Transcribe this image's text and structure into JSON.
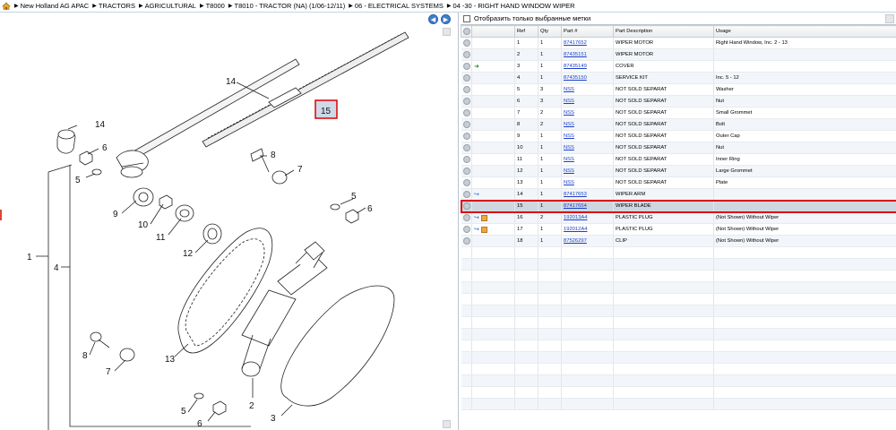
{
  "breadcrumb": {
    "items": [
      "New Holland AG APAC",
      "TRACTORS",
      "AGRICULTURAL",
      "T8000",
      "T8010 - TRACTOR (NA) (1/06-12/11)",
      "06 - ELECTRICAL SYSTEMS",
      "04 -30 - RIGHT HAND WINDOW WIPER"
    ]
  },
  "filter": {
    "label": "Отобразить только выбранные метки"
  },
  "table": {
    "headers": [
      "",
      "",
      "Ref",
      "Qty",
      "Part #",
      "Part Description",
      "Usage"
    ],
    "rows": [
      {
        "ref": "1",
        "qty": "1",
        "part": "87417652",
        "desc": "WIPER MOTOR",
        "usage": "Right Hand Window, Inc. 2 - 13",
        "icons": "none"
      },
      {
        "ref": "2",
        "qty": "1",
        "part": "87435151",
        "desc": "WIPER MOTOR",
        "usage": "",
        "icons": "none"
      },
      {
        "ref": "3",
        "qty": "1",
        "part": "87435149",
        "desc": "COVER",
        "usage": "",
        "icons": "arrow"
      },
      {
        "ref": "4",
        "qty": "1",
        "part": "87435150",
        "desc": "SERVICE KIT",
        "usage": "Inc. 5 - 12",
        "icons": "none"
      },
      {
        "ref": "5",
        "qty": "3",
        "part": "NSS",
        "desc": "NOT SOLD SEPARAT",
        "usage": "Washer",
        "icons": "none"
      },
      {
        "ref": "6",
        "qty": "3",
        "part": "NSS",
        "desc": "NOT SOLD SEPARAT",
        "usage": "Nut",
        "icons": "none"
      },
      {
        "ref": "7",
        "qty": "2",
        "part": "NSS",
        "desc": "NOT SOLD SEPARAT",
        "usage": "Small Grommet",
        "icons": "none"
      },
      {
        "ref": "8",
        "qty": "2",
        "part": "NSS",
        "desc": "NOT SOLD SEPARAT",
        "usage": "Bolt",
        "icons": "none"
      },
      {
        "ref": "9",
        "qty": "1",
        "part": "NSS",
        "desc": "NOT SOLD SEPARAT",
        "usage": "Outer Cap",
        "icons": "none"
      },
      {
        "ref": "10",
        "qty": "1",
        "part": "NSS",
        "desc": "NOT SOLD SEPARAT",
        "usage": "Nut",
        "icons": "none"
      },
      {
        "ref": "11",
        "qty": "1",
        "part": "NSS",
        "desc": "NOT SOLD SEPARAT",
        "usage": "Inner Ring",
        "icons": "none"
      },
      {
        "ref": "12",
        "qty": "1",
        "part": "NSS",
        "desc": "NOT SOLD SEPARAT",
        "usage": "Large Grommet",
        "icons": "none"
      },
      {
        "ref": "13",
        "qty": "1",
        "part": "NSS",
        "desc": "NOT SOLD SEPARAT",
        "usage": "Plate",
        "icons": "none"
      },
      {
        "ref": "14",
        "qty": "1",
        "part": "87417653",
        "desc": "WIPER ARM",
        "usage": "",
        "icons": "share"
      },
      {
        "ref": "15",
        "qty": "1",
        "part": "87417654",
        "desc": "WIPER BLADE",
        "usage": "",
        "icons": "none",
        "selected": true
      },
      {
        "ref": "16",
        "qty": "2",
        "part": "192013A4",
        "desc": "PLASTIC PLUG",
        "usage": "(Not Shown) Without Wiper",
        "icons": "share-box"
      },
      {
        "ref": "17",
        "qty": "1",
        "part": "192012A4",
        "desc": "PLASTIC PLUG",
        "usage": "(Not Shown) Without Wiper",
        "icons": "share-box"
      },
      {
        "ref": "18",
        "qty": "1",
        "part": "87526297",
        "desc": "CLIP",
        "usage": "(Not Shown) Without Wiper",
        "icons": "none"
      }
    ]
  },
  "diagram": {
    "callouts": {
      "c1": "1",
      "c2": "2",
      "c3": "3",
      "c4": "4",
      "c5a": "5",
      "c5b": "5",
      "c5c": "5",
      "c6a": "6",
      "c6b": "6",
      "c6c": "6",
      "c7a": "7",
      "c7b": "7",
      "c8a": "8",
      "c8b": "8",
      "c9": "9",
      "c10": "10",
      "c11": "11",
      "c12": "12",
      "c13": "13",
      "c14a": "14",
      "c14b": "14",
      "c15": "15"
    }
  }
}
